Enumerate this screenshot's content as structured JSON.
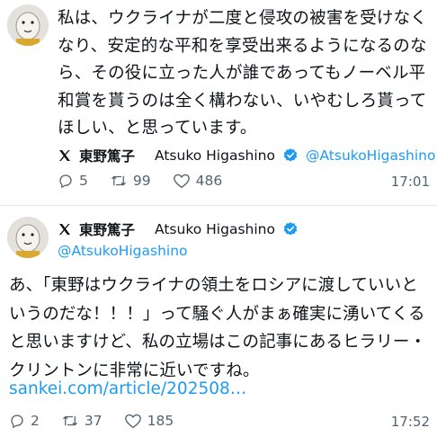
{
  "tweet1": {
    "text": "私は、ウクライナが二度と侵攻の被害を受けなくなり、安定的な平和を享受出来るようになるのなら、その役に立った人が誰であってもノーベル平和賞を貰うのは全く構わない、いやむしろ貰ってほしい、と思っています。",
    "author": {
      "name_jp": "東野篤子",
      "name_en": "Atsuko Higashino",
      "handle": "@AtsukoHigashino"
    },
    "replies": "5",
    "reposts": "99",
    "likes": "486",
    "time": "17:01"
  },
  "tweet2": {
    "author": {
      "name_jp": "東野篤子",
      "name_en": "Atsuko Higashino",
      "handle": "@AtsukoHigashino"
    },
    "text": "あ、「東野はウクライナの領土をロシアに渡していいというのだな！！！」って騒ぐ人がまぁ確実に湧いてくると思いますけど、私の立場はこの記事にあるヒラリー・クリントンに非常に近いですね。",
    "link": "sankei.com/article/202508…",
    "replies": "2",
    "reposts": "37",
    "likes": "185",
    "time": "17:52"
  },
  "colors": {
    "accent": "#1d9bf0",
    "muted": "#536471",
    "text": "#0f1419"
  },
  "icons": [
    "x-logo-icon",
    "verified-badge-icon",
    "reply-icon",
    "repost-icon",
    "like-icon",
    "avatar-icon"
  ]
}
